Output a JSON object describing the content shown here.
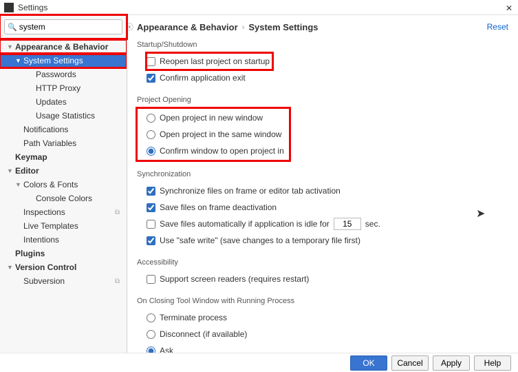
{
  "window": {
    "title": "Settings"
  },
  "search": {
    "value": "system"
  },
  "reset_label": "Reset",
  "sidebar": {
    "items": [
      {
        "label": "Appearance & Behavior",
        "arrow": "▼",
        "bold": true
      },
      {
        "label": "System Settings",
        "arrow": "▼",
        "selected": true
      },
      {
        "label": "Passwords"
      },
      {
        "label": "HTTP Proxy"
      },
      {
        "label": "Updates"
      },
      {
        "label": "Usage Statistics"
      },
      {
        "label": "Notifications"
      },
      {
        "label": "Path Variables"
      },
      {
        "label": "Keymap",
        "bold": true
      },
      {
        "label": "Editor",
        "arrow": "▼",
        "bold": true
      },
      {
        "label": "Colors & Fonts",
        "arrow": "▼"
      },
      {
        "label": "Console Colors"
      },
      {
        "label": "Inspections",
        "badge": "⧉"
      },
      {
        "label": "Live Templates"
      },
      {
        "label": "Intentions"
      },
      {
        "label": "Plugins",
        "bold": true
      },
      {
        "label": "Version Control",
        "arrow": "▼",
        "bold": true
      },
      {
        "label": "Subversion",
        "badge": "⧉"
      }
    ]
  },
  "breadcrumb": {
    "a": "Appearance & Behavior",
    "b": "System Settings"
  },
  "sections": {
    "startup": {
      "title": "Startup/Shutdown",
      "reopen": "Reopen last project on startup",
      "confirm_exit": "Confirm application exit"
    },
    "opening": {
      "title": "Project Opening",
      "opt1": "Open project in new window",
      "opt2": "Open project in the same window",
      "opt3": "Confirm window to open project in"
    },
    "sync": {
      "title": "Synchronization",
      "s1": "Synchronize files on frame or editor tab activation",
      "s2": "Save files on frame deactivation",
      "s3a": "Save files automatically if application is idle for",
      "s3_value": "15",
      "s3b": "sec.",
      "s4": "Use \"safe write\" (save changes to a temporary file first)"
    },
    "access": {
      "title": "Accessibility",
      "a1": "Support screen readers (requires restart)"
    },
    "closing": {
      "title": "On Closing Tool Window with Running Process",
      "c1": "Terminate process",
      "c2": "Disconnect (if available)",
      "c3": "Ask"
    }
  },
  "buttons": {
    "ok": "OK",
    "cancel": "Cancel",
    "apply": "Apply",
    "help": "Help"
  }
}
